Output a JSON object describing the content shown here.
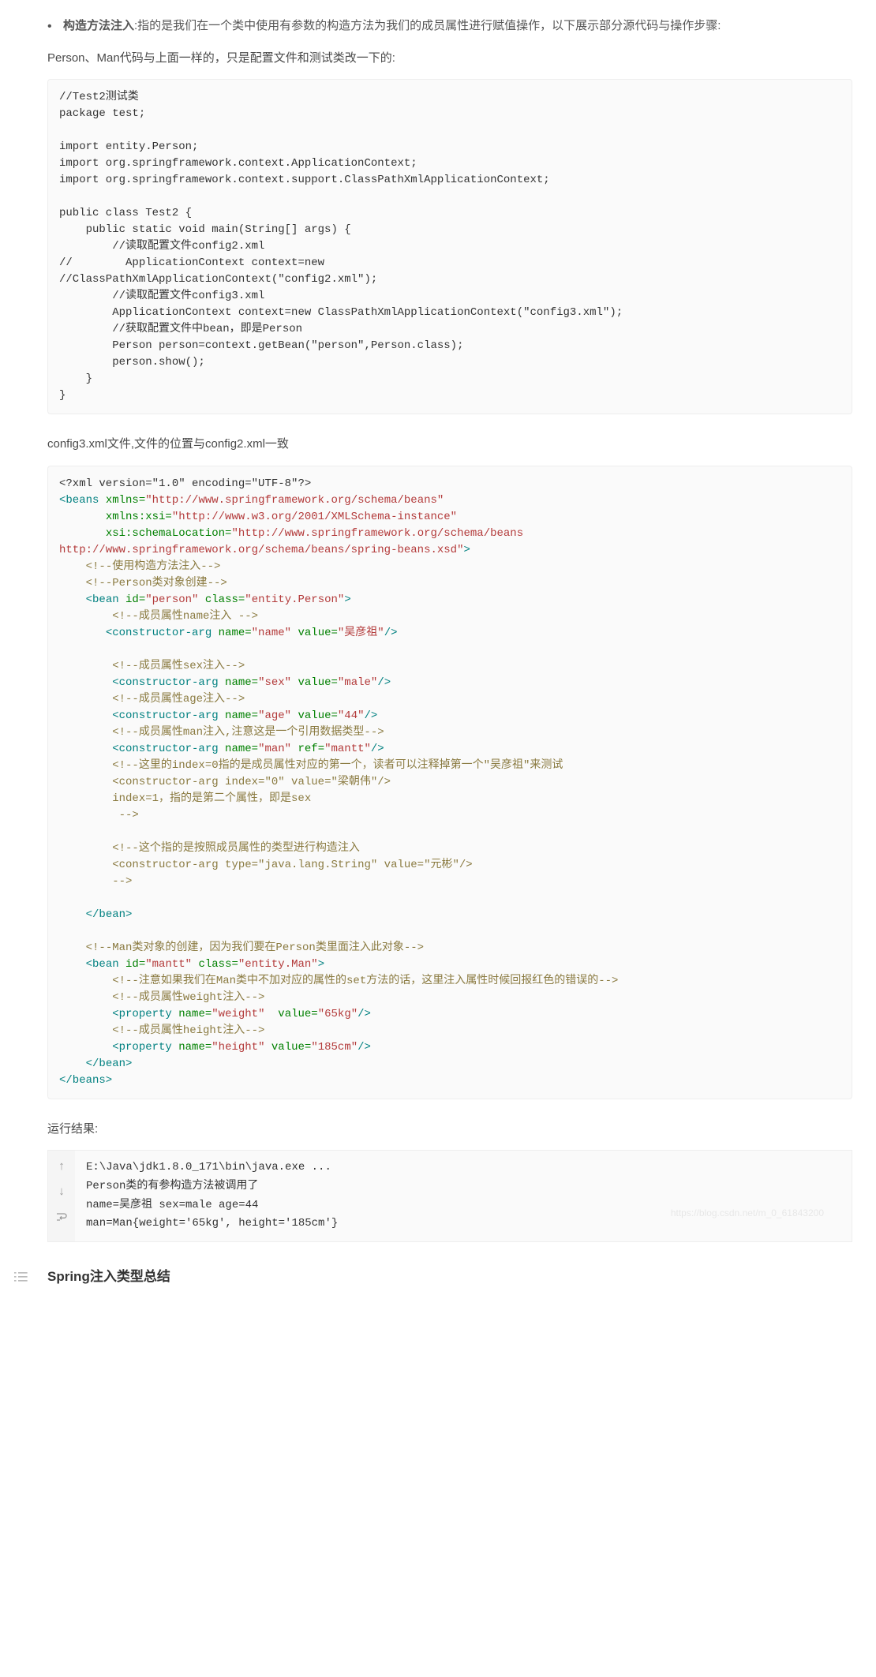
{
  "bullet": {
    "label": "构造方法注入",
    "desc": ":指的是我们在一个类中使用有参数的构造方法为我们的成员属性进行赋值操作，以下展示部分源代码与操作步骤:"
  },
  "paras": {
    "p1": "Person、Man代码与上面一样的，只是配置文件和测试类改一下的:",
    "p2": "config3.xml文件,文件的位置与config2.xml一致",
    "p3": "运行结果:"
  },
  "code_java": "//Test2测试类\npackage test;\n\nimport entity.Person;\nimport org.springframework.context.ApplicationContext;\nimport org.springframework.context.support.ClassPathXmlApplicationContext;\n\npublic class Test2 {\n    public static void main(String[] args) {\n        //读取配置文件config2.xml\n//        ApplicationContext context=new\n//ClassPathXmlApplicationContext(\"config2.xml\");\n        //读取配置文件config3.xml\n        ApplicationContext context=new ClassPathXmlApplicationContext(\"config3.xml\");\n        //获取配置文件中bean，即是Person\n        Person person=context.getBean(\"person\",Person.class);\n        person.show();\n    }\n}",
  "code_xml": {
    "line1": "<?xml version=\"1.0\" encoding=\"UTF-8\"?>",
    "l2a": "<beans",
    "l2b": "xmlns=",
    "l2c": "\"http://www.springframework.org/schema/beans\"",
    "l3a": "xmlns:xsi=",
    "l3b": "\"http://www.w3.org/2001/XMLSchema-instance\"",
    "l4a": "xsi:schemaLocation=",
    "l4b": "\"http://www.springframework.org/schema/beans",
    "l5": "http://www.springframework.org/schema/beans/spring-beans.xsd\"",
    "l5c": ">",
    "c1": "<!--使用构造方法注入-->",
    "c2": "<!--Person类对象创建-->",
    "b1a": "<bean",
    "b1_id": "id=",
    "b1_idv": "\"person\"",
    "b1_cls": "class=",
    "b1_clsv": "\"entity.Person\"",
    "b1c": ">",
    "c3": "<!--成员属性name注入 -->",
    "ca1": "<constructor-arg",
    "ca1n": "name=",
    "ca1nv": "\"name\"",
    "ca1v": "value=",
    "ca1vv": "\"吴彦祖\"",
    "slash": "/>",
    "c4": "<!--成员属性sex注入-->",
    "ca2nv": "\"sex\"",
    "ca2vv": "\"male\"",
    "c5": "<!--成员属性age注入-->",
    "ca3nv": "\"age\"",
    "ca3vv": "\"44\"",
    "c6": "<!--成员属性man注入,注意这是一个引用数据类型-->",
    "ca4nv": "\"man\"",
    "ca4r": "ref=",
    "ca4rv": "\"mantt\"",
    "c7a": "<!--这里的index=0指的是成员属性对应的第一个，读者可以注释掉第一个\"吴彦祖\"来测试",
    "c7b": "<constructor-arg index=\"0\" value=\"梁朝伟\"/>",
    "c7c": "index=1，指的是第二个属性，即是sex",
    "c7d": " -->",
    "c8a": "<!--这个指的是按照成员属性的类型进行构造注入",
    "c8b": "<constructor-arg type=\"java.lang.String\" value=\"元彬\"/>",
    "c8c": "-->",
    "beanEnd": "</bean>",
    "c9": "<!--Man类对象的创建，因为我们要在Person类里面注入此对象-->",
    "b2_idv": "\"mantt\"",
    "b2_clsv": "\"entity.Man\"",
    "b2c": ">",
    "c10": "<!--注意如果我们在Man类中不加对应的属性的set方法的话，这里注入属性时候回报红色的错误的-->",
    "c11": "<!--成员属性weight注入-->",
    "p1": "<property",
    "p1nv": "\"weight\"",
    "p1vv": "\"65kg\"",
    "c12": "<!--成员属性height注入-->",
    "p2nv": "\"height\"",
    "p2vv": "\"185cm\"",
    "beansEnd": "</beans>"
  },
  "output": "E:\\Java\\jdk1.8.0_171\\bin\\java.exe ...\nPerson类的有参构造方法被调用了\nname=吴彦祖 sex=male age=44\nman=Man{weight='65kg', height='185cm'}",
  "heading": "Spring注入类型总结",
  "watermark": "https://blog.csdn.net/m_0_61843200"
}
